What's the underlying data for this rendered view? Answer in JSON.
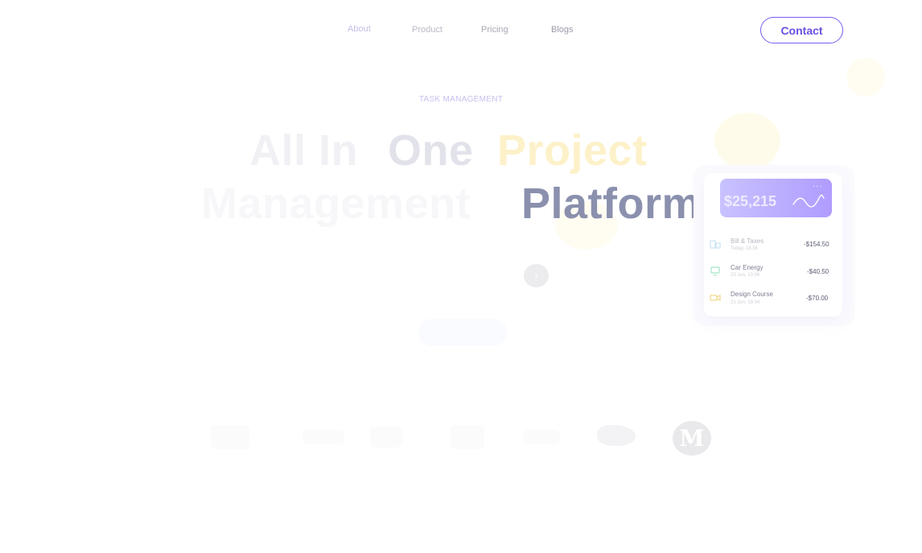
{
  "nav": {
    "links": [
      {
        "label": "About"
      },
      {
        "label": "Product"
      },
      {
        "label": "Pricing"
      },
      {
        "label": "Blogs"
      }
    ],
    "contact_label": "Contact"
  },
  "hero": {
    "eyebrow": "TASK MANAGEMENT",
    "headline_line1": [
      "All In",
      "One",
      "Project"
    ],
    "headline_line2": [
      "Management",
      "Platform"
    ]
  },
  "card": {
    "balance": "$25,215",
    "menu_glyph": "···",
    "transactions": [
      {
        "name": "Bill & Taxes",
        "date": "Today, 16:36",
        "amount": "-$154.50",
        "icon": "building-icon"
      },
      {
        "name": "Car Energy",
        "date": "23 Jun, 13:06",
        "amount": "-$40.50",
        "icon": "monitor-icon"
      },
      {
        "name": "Design Course",
        "date": "21 Jun, 19:04",
        "amount": "-$70.00",
        "icon": "video-icon"
      }
    ]
  },
  "logos": {
    "medium_letter": "M"
  },
  "colors": {
    "accent": "#7b5cf0",
    "balance_gradient_start": "#c8c2ff",
    "balance_gradient_end": "#b09cff",
    "headline_dark": "#8a90ad",
    "headline_yellow": "#fdf1c9"
  }
}
